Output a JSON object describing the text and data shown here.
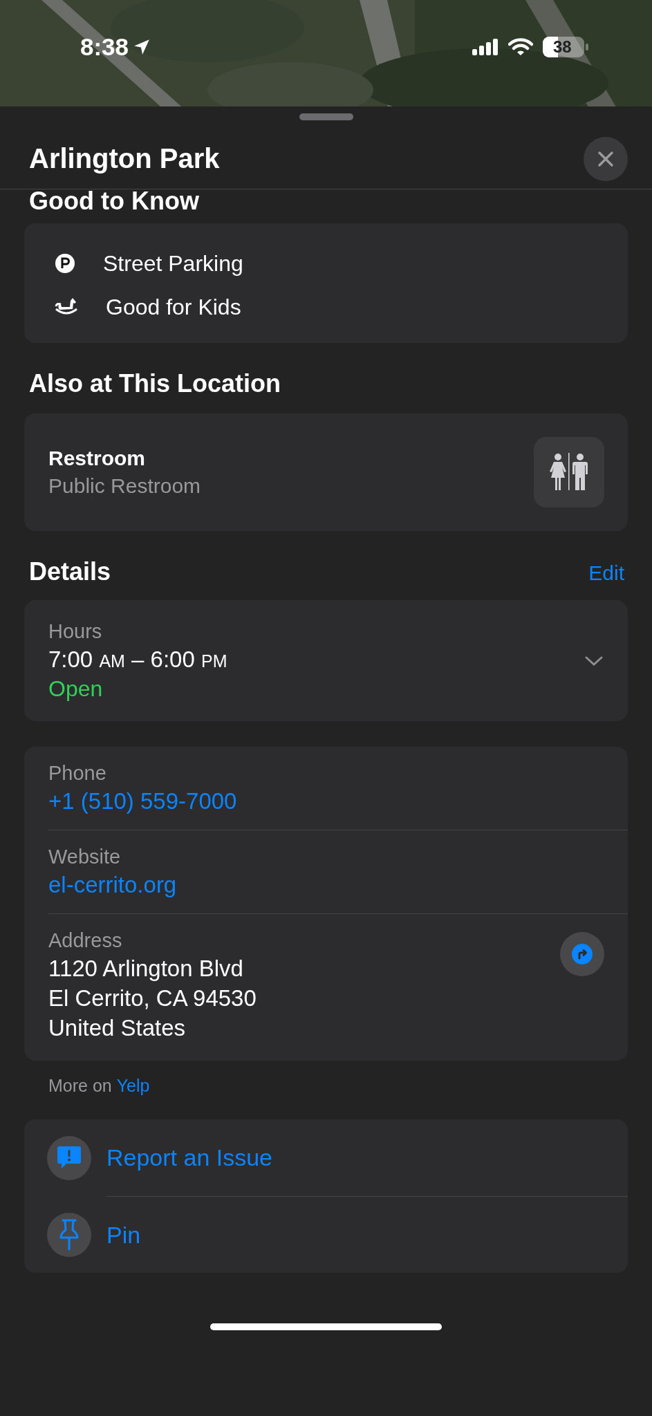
{
  "status_bar": {
    "time": "8:38",
    "battery": "38"
  },
  "sheet": {
    "title": "Arlington Park"
  },
  "good_to_know": {
    "heading": "Good to Know",
    "items": [
      {
        "kind": "parking",
        "label": "Street Parking"
      },
      {
        "kind": "kids",
        "label": "Good for Kids"
      }
    ]
  },
  "also_here": {
    "heading": "Also at This Location",
    "items": [
      {
        "kind": "restroom",
        "title": "Restroom",
        "subtitle": "Public Restroom"
      }
    ]
  },
  "details": {
    "heading": "Details",
    "edit": "Edit",
    "hours": {
      "label": "Hours",
      "segments": [
        {
          "text": "7:00 ",
          "small": false
        },
        {
          "text": "AM",
          "small": true
        },
        {
          "text": " – 6:00 ",
          "small": false
        },
        {
          "text": "PM",
          "small": true
        }
      ],
      "status": "Open",
      "open": true,
      "expanded": false
    },
    "contact": [
      {
        "kind": "link",
        "label": "Phone",
        "lines": [
          "+1 (510) 559-7000"
        ]
      },
      {
        "kind": "link",
        "label": "Website",
        "lines": [
          "el-cerrito.org"
        ]
      },
      {
        "kind": "address",
        "label": "Address",
        "lines": [
          "1120 Arlington Blvd",
          "El Cerrito, CA  94530",
          "United States"
        ]
      }
    ],
    "source_prefix": "More on",
    "source": "Yelp"
  },
  "actions": [
    {
      "kind": "report",
      "label": "Report an Issue"
    },
    {
      "kind": "pin",
      "label": "Pin"
    }
  ]
}
